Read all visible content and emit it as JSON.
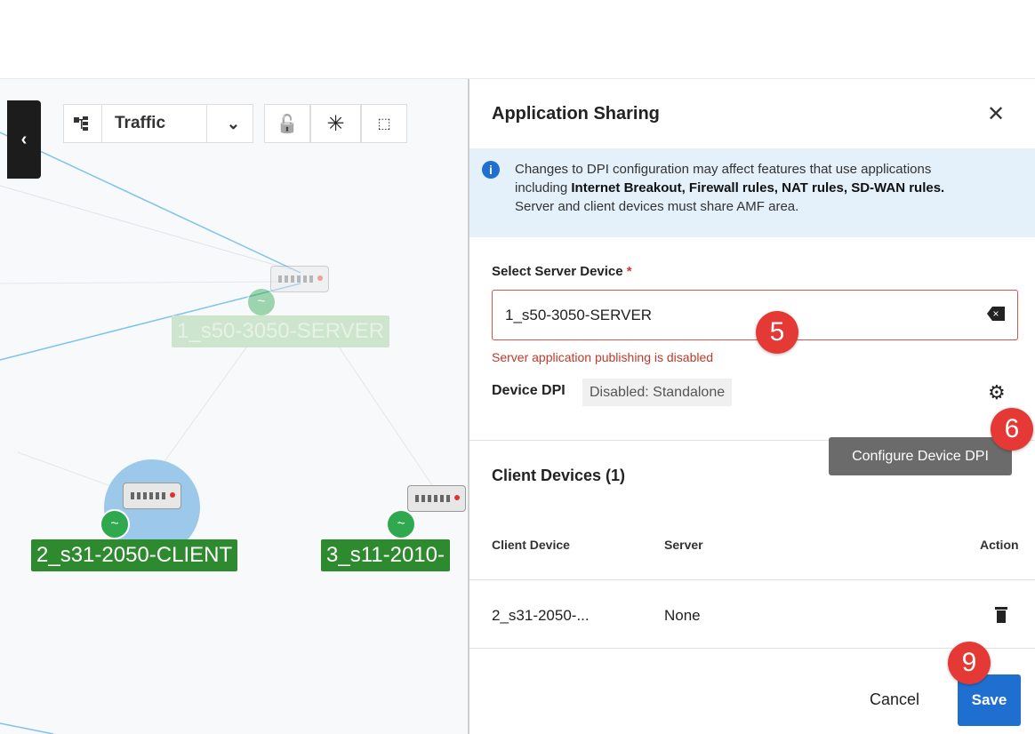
{
  "toolbar": {
    "sidebar_toggle_glyph": "‹",
    "view_mode": "Traffic",
    "dropdown_glyph": "⌄",
    "lock_glyph": "🔓",
    "topology_glyph": "✳",
    "select_glyph": "⬚"
  },
  "topology": {
    "nodes": [
      {
        "label": "1_s50-3050-SERVER",
        "status": "online"
      },
      {
        "label": "2_s31-2050-CLIENT",
        "status": "online"
      },
      {
        "label": "3_s11-2010-",
        "status": "online"
      }
    ]
  },
  "panel": {
    "title": "Application Sharing",
    "close_glyph": "✕",
    "info_glyph": "i",
    "info": {
      "line1": "Changes to DPI configuration may affect features that use applications",
      "line2_prefix": "including ",
      "line2_bold": "Internet Breakout, Firewall rules, NAT rules, SD-WAN rules.",
      "line3": "Server and client devices must share AMF area."
    },
    "server_device": {
      "label": "Select Server Device",
      "required_mark": "*",
      "value": "1_s50-3050-SERVER",
      "clear_glyph": "×",
      "error": "Server application publishing is disabled"
    },
    "device_dpi": {
      "label": "Device DPI",
      "status": "Disabled: Standalone",
      "gear_glyph": "⚙",
      "tooltip": "Configure Device DPI"
    },
    "client_devices": {
      "title": "Client Devices (1)",
      "columns": [
        "Client Device",
        "Server",
        "Action"
      ],
      "rows": [
        {
          "client_device": "2_s31-2050-...",
          "server": "None"
        }
      ]
    },
    "footer": {
      "cancel": "Cancel",
      "save": "Save"
    }
  },
  "step_markers": [
    "5",
    "6",
    "9"
  ],
  "colors": {
    "accent": "#1f6fd1",
    "error": "#c0392b",
    "marker": "#e53935",
    "node_label": "#2e8a2e"
  }
}
